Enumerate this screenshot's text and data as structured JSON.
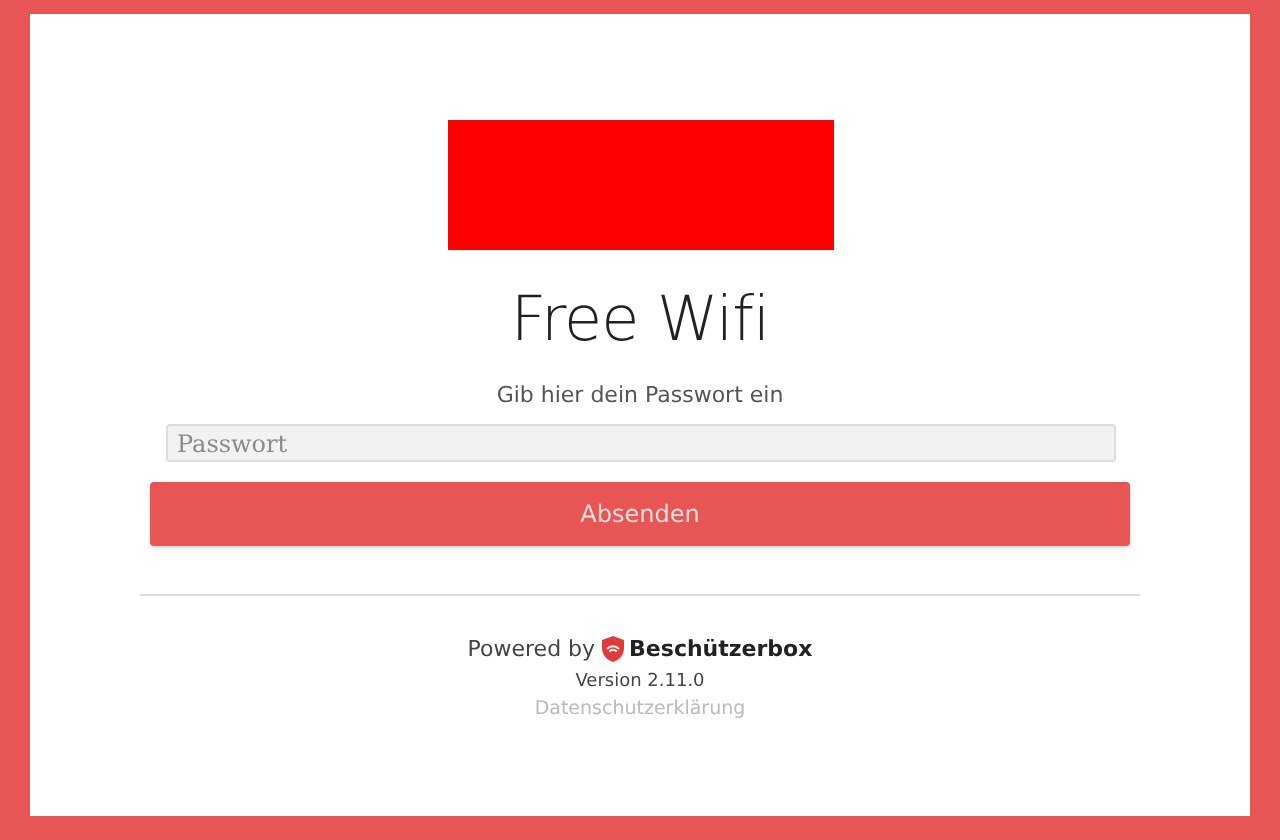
{
  "title": "Free Wifi",
  "prompt": "Gib hier dein Passwort ein",
  "password_field": {
    "placeholder": "Passwort"
  },
  "submit_button": "Absenden",
  "footer": {
    "powered_by": "Powered by",
    "brand": "Beschützerbox",
    "version": "Version 2.11.0",
    "privacy_link": "Datenschutzerklärung"
  }
}
